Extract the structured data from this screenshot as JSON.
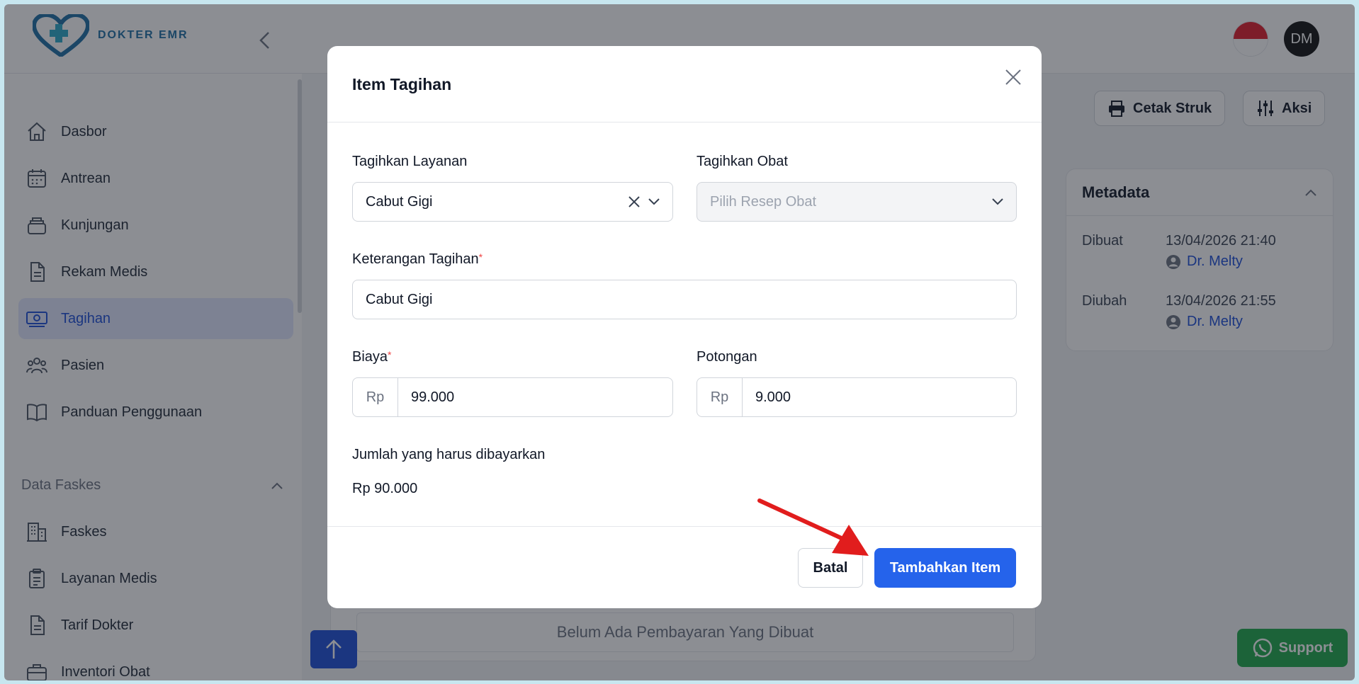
{
  "brand": {
    "name": "DOKTER EMR"
  },
  "header": {
    "avatar_initials": "DM"
  },
  "sidebar": {
    "items": [
      {
        "label": "Dasbor"
      },
      {
        "label": "Antrean"
      },
      {
        "label": "Kunjungan"
      },
      {
        "label": "Rekam Medis"
      },
      {
        "label": "Tagihan",
        "active": true
      },
      {
        "label": "Pasien"
      },
      {
        "label": "Panduan Penggunaan"
      }
    ],
    "section_title": "Data Faskes",
    "section_items": [
      {
        "label": "Faskes"
      },
      {
        "label": "Layanan Medis"
      },
      {
        "label": "Tarif Dokter"
      },
      {
        "label": "Inventori Obat"
      }
    ]
  },
  "toolbar": {
    "print_label": "Cetak Struk",
    "actions_label": "Aksi"
  },
  "metadata": {
    "title": "Metadata",
    "created_label": "Dibuat",
    "created_at": "13/04/2026 21:40",
    "created_by": "Dr. Melty",
    "updated_label": "Diubah",
    "updated_at": "13/04/2026 21:55",
    "updated_by": "Dr. Melty"
  },
  "background": {
    "empty_payment_text": "Belum Ada Pembayaran Yang Dibuat"
  },
  "support": {
    "label": "Support"
  },
  "modal": {
    "title": "Item Tagihan",
    "service_label": "Tagihkan Layanan",
    "service_value": "Cabut Gigi",
    "drug_label": "Tagihkan Obat",
    "drug_placeholder": "Pilih Resep Obat",
    "description_label": "Keterangan Tagihan",
    "description_value": "Cabut Gigi",
    "cost_label": "Biaya",
    "currency_prefix": "Rp",
    "cost_value": "99.000",
    "discount_label": "Potongan",
    "discount_value": "9.000",
    "total_label": "Jumlah yang harus dibayarkan",
    "total_value": "Rp 90.000",
    "cancel_label": "Batal",
    "submit_label": "Tambahkan Item"
  },
  "colors": {
    "primary": "#2563eb",
    "support": "#1ea84a",
    "annotation_arrow": "#e11d1d"
  }
}
